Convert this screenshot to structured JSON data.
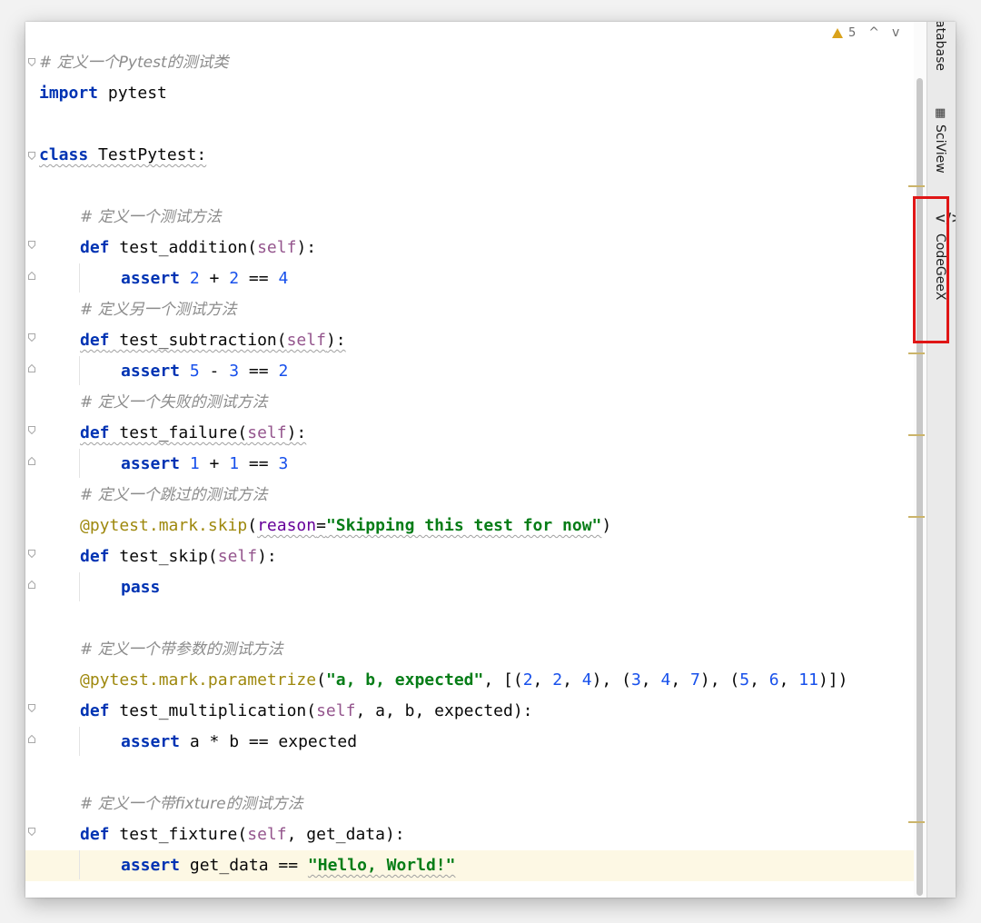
{
  "inspections": {
    "warning_count": "5",
    "up": "^",
    "down": "v"
  },
  "side_panel": {
    "database_label": "atabase",
    "sciview_label": "SciView",
    "codegeex_label": "CodeGeeX"
  },
  "code": {
    "c1_hash": "# ",
    "c1_a": "定义一个",
    "c1_b": "Pytest",
    "c1_c": "的测试类",
    "import_kw": "import",
    "import_mod": " pytest",
    "class_kw": "class",
    "class_name": " TestPytest:",
    "c2": "# 定义一个测试方法",
    "def": "def",
    "f1_name": " test_addition(",
    "self": "self",
    "close_colon": "):",
    "assert": "assert",
    "a1_n1": "2",
    "a1_op1": " + ",
    "a1_n2": "2",
    "a1_op2": " == ",
    "a1_n3": "4",
    "c3": "# 定义另一个测试方法",
    "f2_name": " test_subtraction(",
    "a2_n1": "5",
    "a2_op1": " - ",
    "a2_n2": "3",
    "a2_op2": " == ",
    "a2_n3": "2",
    "c4": "# 定义一个失败的测试方法",
    "f3_name": " test_failure(",
    "a3_n1": "1",
    "a3_op1": " + ",
    "a3_n2": "1",
    "a3_op2": " == ",
    "a3_n3": "3",
    "c5": "# 定义一个跳过的测试方法",
    "skip_deco": "@pytest.mark.skip",
    "skip_open": "(",
    "skip_param": "reason",
    "skip_eq": "=",
    "skip_str": "\"Skipping this test for now\"",
    "skip_close": ")",
    "f4_name": " test_skip(",
    "pass": "pass",
    "c6": "# 定义一个带参数的测试方法",
    "par_deco": "@pytest.mark.parametrize",
    "par_open": "(",
    "par_str": "\"a, b, expected\"",
    "par_mid": ", [(",
    "p1": "2",
    "p2": "2",
    "p3": "4",
    "p4": "3",
    "p5": "4",
    "p6": "7",
    "p7": "5",
    "p8": "6",
    "p9": "11",
    "sep": ", ",
    "tup_sep": "), (",
    "par_end": ")])",
    "f5_name": " test_multiplication(",
    "f5_args": ", a, b, expected):",
    "a5_rest": " a * b == expected",
    "c7_a": "# 定义一个带",
    "c7_b": "fixture",
    "c7_c": "的测试方法",
    "f6_name": " test_fixture(",
    "f6_args": ", get_data):",
    "a6_rest": " get_data == ",
    "a6_str": "\"Hello, World!\""
  }
}
